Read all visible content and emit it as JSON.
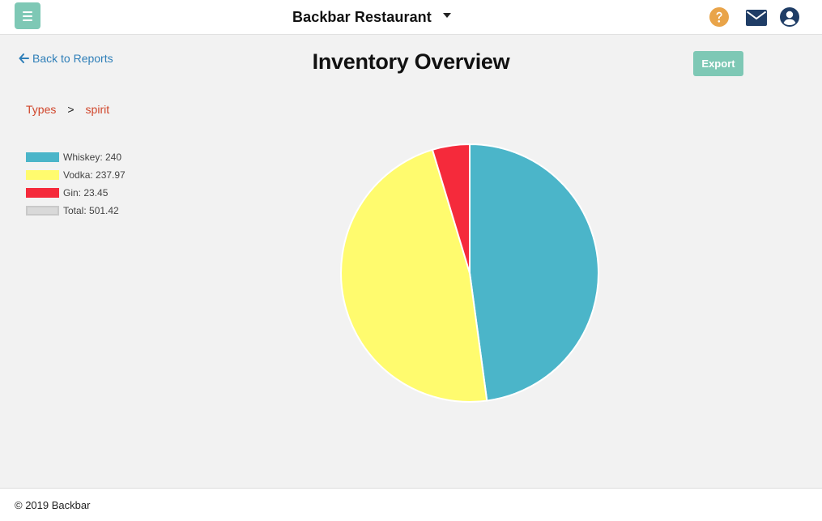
{
  "header": {
    "restaurant_name": "Backbar Restaurant",
    "icons": [
      "menu-icon",
      "help-icon",
      "mail-icon",
      "user-icon"
    ]
  },
  "page": {
    "back_label": "Back to Reports",
    "title": "Inventory Overview",
    "export_label": "Export"
  },
  "breadcrumb": {
    "items": [
      "Types",
      "spirit"
    ],
    "separator": ">"
  },
  "legend": {
    "items": [
      {
        "label": "Whiskey: 240",
        "color": "#4bb5c9"
      },
      {
        "label": "Vodka: 237.97",
        "color": "#fffb6e"
      },
      {
        "label": "Gin: 23.45",
        "color": "#f52a3b"
      },
      {
        "label": "Total: 501.42",
        "color": "#d9d9d9"
      }
    ]
  },
  "chart_data": {
    "type": "pie",
    "series": [
      {
        "name": "Whiskey",
        "value": 240,
        "color": "#4bb5c9"
      },
      {
        "name": "Vodka",
        "value": 237.97,
        "color": "#fffb6e"
      },
      {
        "name": "Gin",
        "value": 23.45,
        "color": "#f52a3b"
      }
    ],
    "total": 501.42,
    "legend_position": "left"
  },
  "colors": {
    "accent": "#7ec8b5",
    "link": "#2f7fb8",
    "breadcrumb": "#d0452a",
    "help": "#e9a449",
    "icon_dark": "#1f3d66"
  },
  "footer": {
    "text": "© 2019 Backbar"
  }
}
